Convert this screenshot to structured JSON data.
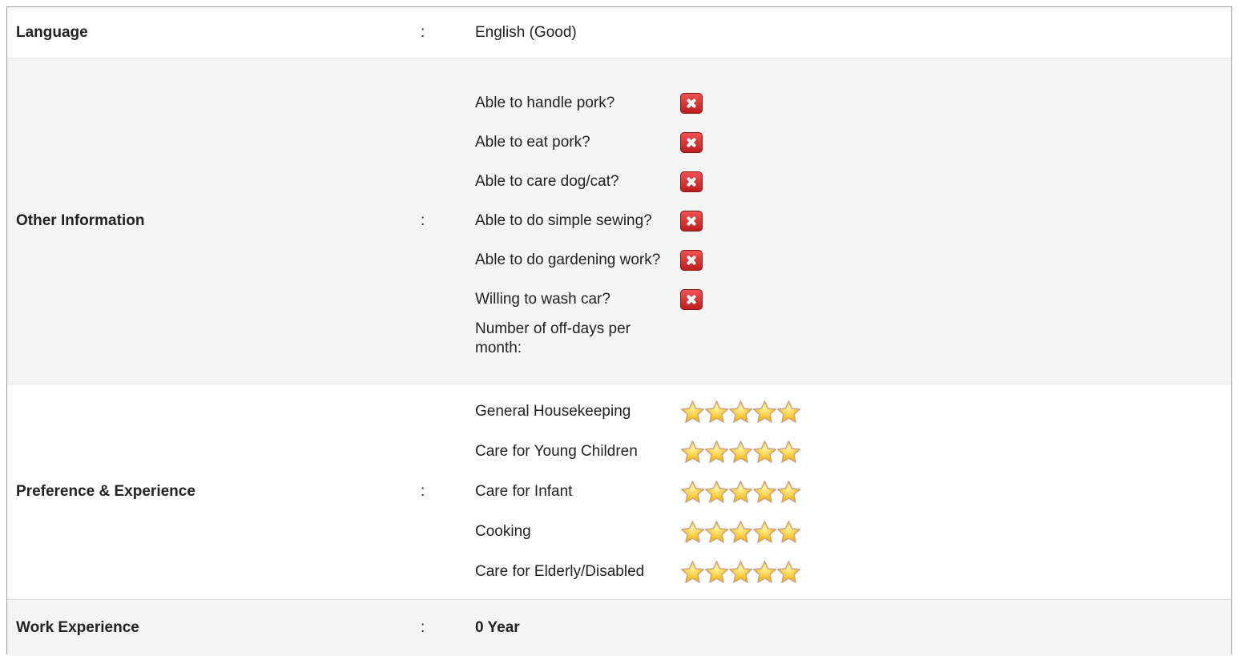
{
  "rows": {
    "language": {
      "label": "Language",
      "colon": ":",
      "value": "English (Good)"
    },
    "other_information": {
      "label": "Other Information",
      "colon": ":",
      "items": [
        {
          "text": "Able to handle pork?",
          "answer_icon": "cross-icon"
        },
        {
          "text": "Able to eat pork?",
          "answer_icon": "cross-icon"
        },
        {
          "text": "Able to care dog/cat?",
          "answer_icon": "cross-icon"
        },
        {
          "text": "Able to do simple sewing?",
          "answer_icon": "cross-icon"
        },
        {
          "text": "Able to do gardening work?",
          "answer_icon": "cross-icon"
        },
        {
          "text": "Willing to wash car?",
          "answer_icon": "cross-icon"
        },
        {
          "text": "Number of off-days per month:",
          "answer_icon": ""
        }
      ]
    },
    "preference_experience": {
      "label": "Preference & Experience",
      "colon": ":",
      "items": [
        {
          "text": "General Housekeeping",
          "rating": 5,
          "max_rating": 5
        },
        {
          "text": "Care for Young Children",
          "rating": 5,
          "max_rating": 5
        },
        {
          "text": "Care for Infant",
          "rating": 5,
          "max_rating": 5
        },
        {
          "text": "Cooking",
          "rating": 5,
          "max_rating": 5
        },
        {
          "text": "Care for Elderly/Disabled",
          "rating": 5,
          "max_rating": 5
        }
      ]
    },
    "work_experience": {
      "label": "Work Experience",
      "colon": ":",
      "value": "0 Year"
    }
  },
  "colors": {
    "row_alt_background": "#f5f5f5",
    "cross_icon": "#d32f2f",
    "star_fill": "#f7b500"
  }
}
